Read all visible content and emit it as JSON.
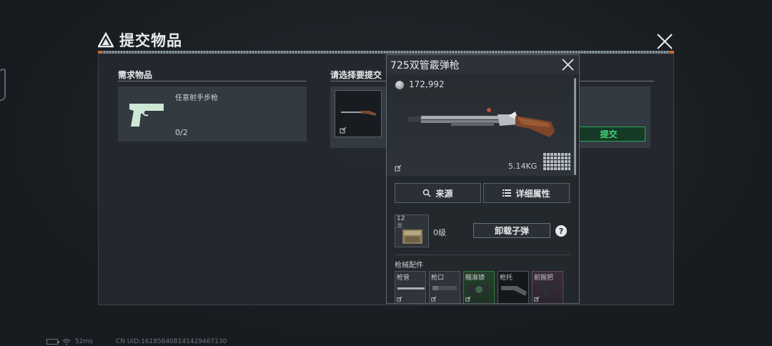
{
  "title": "提交物品",
  "required_section": {
    "header": "需求物品",
    "item_name": "任意射手步枪",
    "count": "0/2"
  },
  "select_section": {
    "header": "请选择要提交",
    "submit_label": "提交"
  },
  "detail": {
    "title": "725双管霰弹枪",
    "price": "172,992",
    "weight": "5.14KG",
    "source_label": "来源",
    "attributes_label": "详细属性",
    "ammo": {
      "count": "12",
      "sub": "龙",
      "level": "0级",
      "unload_label": "卸载子弹",
      "help": "?"
    },
    "attachments_header": "枪械配件",
    "attachments": [
      {
        "label": "枪管",
        "style": "normal"
      },
      {
        "label": "枪口",
        "style": "normal"
      },
      {
        "label": "瞄准镜",
        "style": "green"
      },
      {
        "label": "枪托",
        "style": "dark"
      },
      {
        "label": "前握把",
        "style": "purple"
      }
    ]
  },
  "status_bar": {
    "ping": "52ms",
    "uid": "CN UID:161856408141429467130"
  },
  "colors": {
    "submit_green": "#3fd57a",
    "accent_orange": "#c86a2c"
  }
}
